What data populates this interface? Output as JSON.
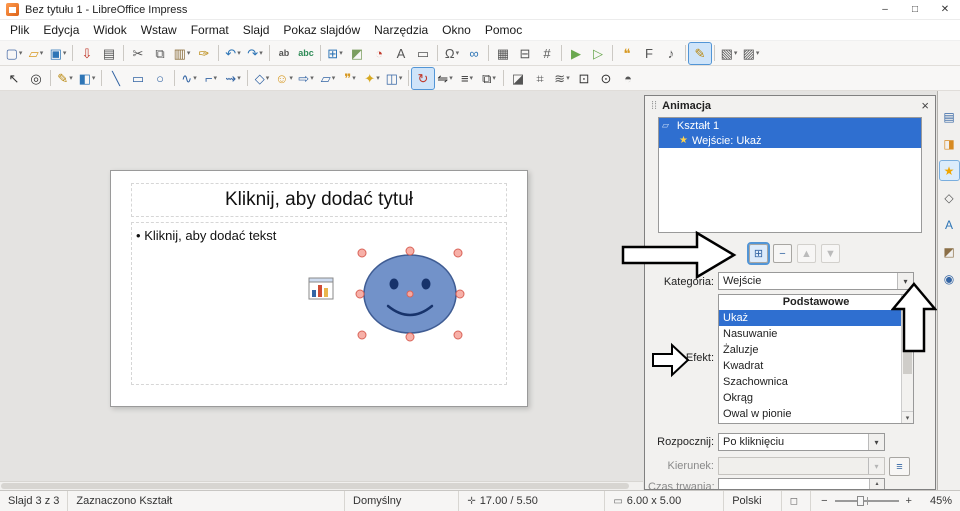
{
  "window": {
    "title": "Bez tytułu 1 - LibreOffice Impress",
    "controls": {
      "minimize": "–",
      "maximize": "□",
      "close": "✕"
    }
  },
  "menubar": {
    "items": [
      "Plik",
      "Edycja",
      "Widok",
      "Wstaw",
      "Format",
      "Slajd",
      "Pokaz slajdów",
      "Narzędzia",
      "Okno",
      "Pomoc"
    ]
  },
  "toolbar_main": {
    "buttons": [
      {
        "name": "new-document-button",
        "glyph": "▢",
        "color": "#4a6da7",
        "dd": true
      },
      {
        "name": "open-button",
        "glyph": "▱",
        "color": "#d79922",
        "dd": true
      },
      {
        "name": "save-button",
        "glyph": "▣",
        "color": "#2e75b6",
        "dd": true
      },
      {
        "sep": true
      },
      {
        "name": "export-pdf-button",
        "glyph": "⇩",
        "color": "#c0392b"
      },
      {
        "name": "print-button",
        "glyph": "▤",
        "color": "#555555"
      },
      {
        "sep": true
      },
      {
        "name": "cut-button",
        "glyph": "✂",
        "color": "#555555"
      },
      {
        "name": "copy-button",
        "glyph": "⧉",
        "color": "#555555"
      },
      {
        "name": "paste-button",
        "glyph": "▥",
        "color": "#8a6d3b",
        "dd": true
      },
      {
        "name": "clone-formatting-button",
        "glyph": "✑",
        "color": "#b8860b"
      },
      {
        "sep": true
      },
      {
        "name": "undo-button",
        "glyph": "↶",
        "color": "#2e75b6",
        "dd": true
      },
      {
        "name": "redo-button",
        "glyph": "↷",
        "color": "#2e75b6",
        "dd": true
      },
      {
        "sep": true
      },
      {
        "name": "find-replace-button",
        "glyph": "ab",
        "color": "#555555",
        "txt": true
      },
      {
        "name": "spelling-button",
        "glyph": "abc",
        "color": "#2e8b57",
        "txt": true
      },
      {
        "sep": true
      },
      {
        "name": "insert-table-button",
        "glyph": "⊞",
        "color": "#2e75b6",
        "dd": true
      },
      {
        "name": "insert-image-button",
        "glyph": "◩",
        "color": "#7b9e5f"
      },
      {
        "name": "insert-chart-button",
        "glyph": "◔",
        "color": "#c0392b"
      },
      {
        "name": "insert-textbox-button",
        "glyph": "A",
        "color": "#555555"
      },
      {
        "name": "header-footer-button",
        "glyph": "▭",
        "color": "#555555"
      },
      {
        "sep": true
      },
      {
        "name": "special-character-button",
        "glyph": "Ω",
        "color": "#555555",
        "dd": true
      },
      {
        "name": "hyperlink-button",
        "glyph": "∞",
        "color": "#2e75b6"
      },
      {
        "sep": true
      },
      {
        "name": "display-grid-button",
        "glyph": "▦",
        "color": "#555555"
      },
      {
        "name": "snap-to-grid-button",
        "glyph": "⊟",
        "color": "#555555"
      },
      {
        "name": "helplines-button",
        "glyph": "#",
        "color": "#555555"
      },
      {
        "sep": true
      },
      {
        "name": "start-from-first-slide-button",
        "glyph": "▶",
        "color": "#6aa84f"
      },
      {
        "name": "start-from-current-slide-button",
        "glyph": "▷",
        "color": "#6aa84f"
      },
      {
        "sep": true
      },
      {
        "name": "insert-comment-button",
        "glyph": "❝",
        "color": "#d79922"
      },
      {
        "name": "insert-fontwork-button",
        "glyph": "F",
        "color": "#555555"
      },
      {
        "name": "insert-media-button",
        "glyph": "♪",
        "color": "#555555"
      },
      {
        "sep": true
      },
      {
        "name": "show-draw-functions-button",
        "glyph": "✎",
        "color": "#b8860b",
        "active": true
      },
      {
        "sep": true
      },
      {
        "name": "new-slide-button",
        "glyph": "▧",
        "color": "#555555",
        "dd": true
      },
      {
        "name": "slide-layout-button",
        "glyph": "▨",
        "color": "#555555",
        "dd": true
      }
    ]
  },
  "toolbar_drawing": {
    "buttons": [
      {
        "name": "select-tool",
        "glyph": "↖",
        "color": "#333333"
      },
      {
        "name": "zoom-pan-tool",
        "glyph": "◎",
        "color": "#333333"
      },
      {
        "sep": true
      },
      {
        "name": "line-color-button",
        "glyph": "✎",
        "color": "#b8860b",
        "dd": true
      },
      {
        "name": "fill-color-button",
        "glyph": "◧",
        "color": "#2e75b6",
        "dd": true
      },
      {
        "sep": true
      },
      {
        "name": "insert-line-tool",
        "glyph": "╲",
        "color": "#3465a4"
      },
      {
        "name": "rectangle-tool",
        "glyph": "▭",
        "color": "#3465a4"
      },
      {
        "name": "ellipse-tool",
        "glyph": "○",
        "color": "#3465a4"
      },
      {
        "sep": true
      },
      {
        "name": "curve-tool",
        "glyph": "∿",
        "color": "#3465a4",
        "dd": true
      },
      {
        "name": "connector-tool",
        "glyph": "⌐",
        "color": "#3465a4",
        "dd": true
      },
      {
        "name": "lines-arrows-tool",
        "glyph": "⇝",
        "color": "#3465a4",
        "dd": true
      },
      {
        "sep": true
      },
      {
        "name": "basic-shapes-tool",
        "glyph": "◇",
        "color": "#3465a4",
        "dd": true
      },
      {
        "name": "symbol-shapes-tool",
        "glyph": "☺",
        "color": "#d79922",
        "dd": true
      },
      {
        "name": "block-arrows-tool",
        "glyph": "⇨",
        "color": "#3465a4",
        "dd": true
      },
      {
        "name": "flowchart-tool",
        "glyph": "▱",
        "color": "#3465a4",
        "dd": true
      },
      {
        "name": "callouts-tool",
        "glyph": "❞",
        "color": "#d79922",
        "dd": true
      },
      {
        "name": "stars-tool",
        "glyph": "✦",
        "color": "#d7a922",
        "dd": true
      },
      {
        "name": "3d-objects-tool",
        "glyph": "◫",
        "color": "#3465a4",
        "dd": true
      },
      {
        "sep": true
      },
      {
        "name": "rotate-tool",
        "glyph": "↻",
        "color": "#c0392b",
        "active": true
      },
      {
        "name": "flip-tool",
        "glyph": "⇋",
        "color": "#333333",
        "dd": true
      },
      {
        "name": "align-tool",
        "glyph": "≡",
        "color": "#333333",
        "dd": true
      },
      {
        "name": "arrange-tool",
        "glyph": "⧉",
        "color": "#333333",
        "dd": true
      },
      {
        "sep": true
      },
      {
        "name": "shadow-button",
        "glyph": "◪",
        "color": "#555555"
      },
      {
        "name": "crop-button",
        "glyph": "⌗",
        "color": "#555555"
      },
      {
        "name": "image-filter-button",
        "glyph": "≋",
        "color": "#555555",
        "dd": true
      },
      {
        "name": "edit-points-button",
        "glyph": "⊡",
        "color": "#333333"
      },
      {
        "name": "gluepoints-button",
        "glyph": "⊙",
        "color": "#333333"
      },
      {
        "name": "extrusion-button",
        "glyph": "◓",
        "color": "#555555"
      }
    ]
  },
  "slide": {
    "title_placeholder": "Kliknij, aby dodać tytuł",
    "bullet": "•",
    "text_placeholder": "Kliknij, aby dodać tekst"
  },
  "animation_panel": {
    "title": "Animacja",
    "effects_applied": [
      {
        "name": "animation-list-item-shape",
        "glyph": "▱",
        "star": "",
        "label": "Kształt 1",
        "selected": true
      },
      {
        "name": "animation-list-item-effect",
        "glyph": "",
        "star": "★",
        "label": "Wejście: Ukaż",
        "selected": true,
        "indent": true
      }
    ],
    "list_buttons": [
      {
        "name": "add-effect-button",
        "glyph": "⊞",
        "active": true
      },
      {
        "name": "remove-effect-button",
        "glyph": "−"
      },
      {
        "name": "move-up-button",
        "glyph": "▲",
        "disabled": true
      },
      {
        "name": "move-down-button",
        "glyph": "▼",
        "disabled": true
      }
    ],
    "category_label": "Kategoria:",
    "category_value": "Wejście",
    "effect_label": "Efekt:",
    "effect_group_header": "Podstawowe",
    "effect_options": [
      {
        "label": "Ukaż",
        "selected": true
      },
      {
        "label": "Nasuwanie"
      },
      {
        "label": "Żaluzje"
      },
      {
        "label": "Kwadrat"
      },
      {
        "label": "Szachownica"
      },
      {
        "label": "Okrąg"
      },
      {
        "label": "Owal w pionie"
      }
    ],
    "start_label": "Rozpocznij:",
    "start_value": "Po kliknięciu",
    "direction_label": "Kierunek:",
    "direction_value": "",
    "duration_label": "Czas trwania:",
    "duration_value": ""
  },
  "sidebar_tabs": [
    {
      "name": "tab-properties",
      "glyph": "▤",
      "color": "#3465a4"
    },
    {
      "name": "tab-slide-transition",
      "glyph": "◨",
      "color": "#d78a22"
    },
    {
      "name": "tab-animation",
      "glyph": "★",
      "color": "#f0a500",
      "active": true
    },
    {
      "name": "tab-shapes",
      "glyph": "◇",
      "color": "#555555"
    },
    {
      "name": "tab-styles",
      "glyph": "A",
      "color": "#2e75b6"
    },
    {
      "name": "tab-gallery",
      "glyph": "◩",
      "color": "#8b6f47"
    },
    {
      "name": "tab-navigator",
      "glyph": "◉",
      "color": "#3465a4"
    }
  ],
  "statusbar": {
    "slide_info": "Slajd 3 z 3",
    "selection_info": "Zaznaczono Kształt",
    "template_name": "Domyślny",
    "position_icon": "✛",
    "position": "17.00 / 5.50",
    "size_icon": "▭",
    "size": "6.00 x 5.00",
    "language": "Polski",
    "fit_icon": "◻",
    "zoom_minus": "−",
    "zoom_plus": "+",
    "zoom_value": "45%"
  },
  "icons": {
    "combo_arrow": "▾",
    "close": "×",
    "grip": "⁞⁞",
    "scroll_down": "▾",
    "spin_up": "▴",
    "spin_down": "▾",
    "options_button": "≡"
  }
}
